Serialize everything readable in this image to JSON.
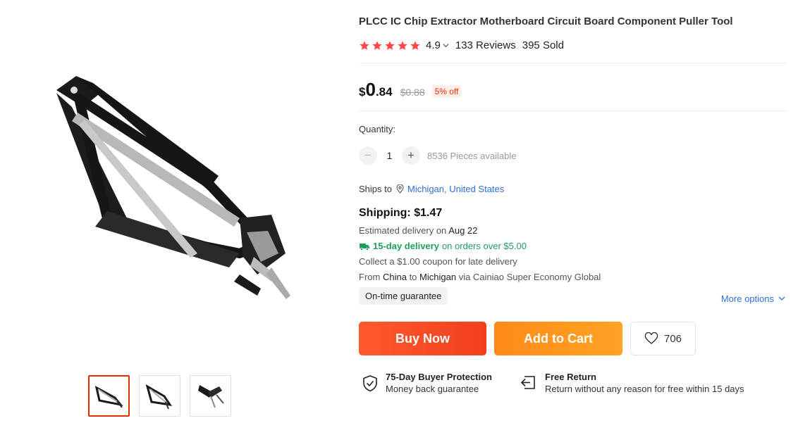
{
  "product": {
    "title": "PLCC IC Chip Extractor Motherboard Circuit Board Component Puller Tool",
    "rating": "4.9",
    "rating_stars": 5,
    "reviews": "133 Reviews",
    "sold": "395 Sold"
  },
  "price": {
    "currency": "$",
    "integer": "0",
    "decimal": ".84",
    "original": "$0.88",
    "discount": "5% off"
  },
  "quantity": {
    "label": "Quantity:",
    "value": "1",
    "minus": "−",
    "plus": "+",
    "available": "8536 Pieces available"
  },
  "shipping": {
    "ships_to_label": "Ships to",
    "location": "Michigan, United States",
    "price": "Shipping: $1.47",
    "estimated_label": "Estimated delivery on",
    "estimated_date": "Aug 22",
    "fast_delivery": "15-day delivery",
    "fast_delivery_rest": "on orders over $5.00",
    "coupon": "Collect a $1.00 coupon for late delivery",
    "from_label": "From",
    "from": "China",
    "to_label": "to",
    "to": "Michigan",
    "via": "via Cainiao Super Economy Global",
    "guarantee": "On-time guarantee",
    "more_options": "More options"
  },
  "actions": {
    "buy_now": "Buy Now",
    "add_to_cart": "Add to Cart",
    "wishlist_count": "706"
  },
  "promises": {
    "protection_title": "75-Day Buyer Protection",
    "protection_sub": "Money back guarantee",
    "return_title": "Free Return",
    "return_sub": "Return without any reason for free within 15 days"
  },
  "colors": {
    "accent_red": "#e62e04",
    "star": "#ff4747",
    "buy_now": "#f5492a",
    "add_to_cart": "#ff9a1f",
    "link": "#2e6fd8",
    "green": "#1e9e5b"
  },
  "gallery": {
    "thumbnail_count": 3,
    "active_index": 0
  }
}
